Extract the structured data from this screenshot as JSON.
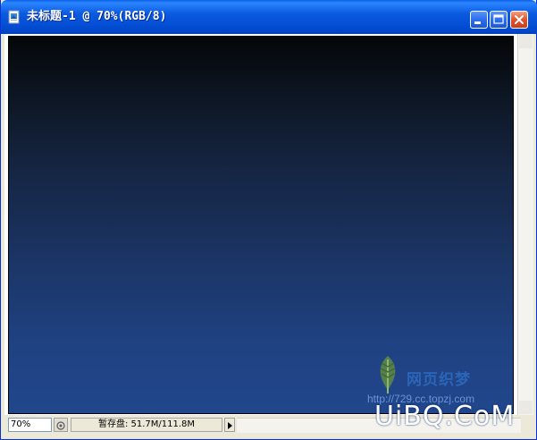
{
  "window": {
    "title": "未标题-1 @ 70%(RGB/8)"
  },
  "icons": {
    "app": "photoshop-document-icon",
    "minimize": "minimize-icon",
    "maximize": "maximize-icon",
    "close": "close-icon",
    "navigate": "navigator-icon",
    "menu_arrow": "triangle-right-icon",
    "watermark_logo": "leaf-logo-icon"
  },
  "colors": {
    "titlebar": "#0450d6",
    "canvas_top": "#050608",
    "canvas_bottom": "#21468b",
    "close_button": "#e0532e"
  },
  "status": {
    "zoom": "70%",
    "scratch_disk": "暂存盘: 51.7M/111.8M"
  },
  "watermarks": {
    "site_name": "网页织梦",
    "site_url": "http://729.cc.topzj.com",
    "brand": "UiBQ.CoM"
  }
}
